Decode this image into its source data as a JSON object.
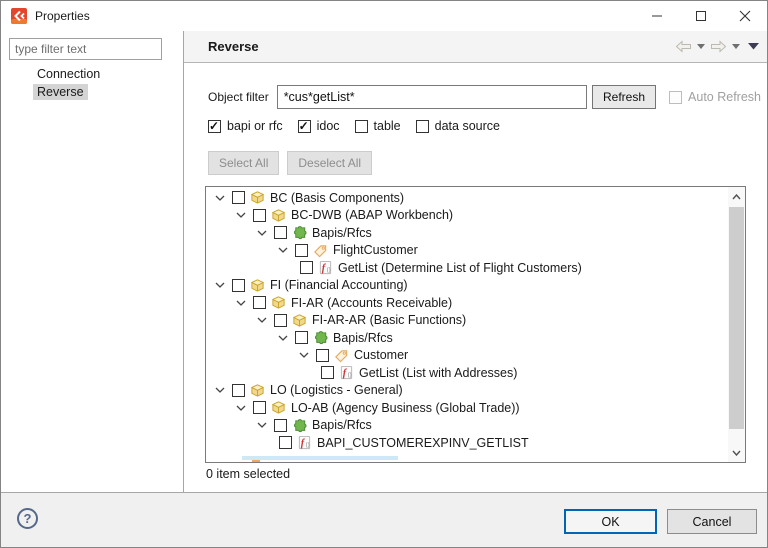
{
  "window": {
    "title": "Properties",
    "controls": [
      {
        "name": "minimize-button",
        "icon": "minimize-icon"
      },
      {
        "name": "maximize-button",
        "icon": "maximize-icon"
      },
      {
        "name": "close-button",
        "icon": "close-icon"
      }
    ],
    "app_icon": "sap-connection-icon"
  },
  "sidebar": {
    "filter_placeholder": "type filter text",
    "items": [
      {
        "label": "Connection",
        "selected": false
      },
      {
        "label": "Reverse",
        "selected": true
      }
    ]
  },
  "header": {
    "title": "Reverse",
    "nav_icons": [
      "back-arrow-icon",
      "back-dropdown-icon",
      "forward-arrow-icon",
      "forward-dropdown-icon",
      "view-menu-icon"
    ]
  },
  "filter_row": {
    "label": "Object filter",
    "value": "*cus*getList*",
    "refresh_label": "Refresh",
    "auto_refresh_label": "Auto Refresh",
    "auto_refresh_checked": false,
    "auto_refresh_enabled": false
  },
  "type_filters": [
    {
      "label": "bapi or rfc",
      "checked": true
    },
    {
      "label": "idoc",
      "checked": true
    },
    {
      "label": "table",
      "checked": false
    },
    {
      "label": "data source",
      "checked": false
    }
  ],
  "actions": {
    "select_all": "Select All",
    "deselect_all": "Deselect All",
    "enabled": false
  },
  "tree": {
    "rows": [
      {
        "level": 0,
        "icon": "package-icon",
        "expandable": true,
        "checked": false,
        "label": "BC (Basis Components)"
      },
      {
        "level": 1,
        "icon": "package-icon",
        "expandable": true,
        "checked": false,
        "label": "BC-DWB (ABAP Workbench)"
      },
      {
        "level": 2,
        "icon": "puzzle-icon",
        "expandable": true,
        "checked": false,
        "label": "Bapis/Rfcs"
      },
      {
        "level": 3,
        "icon": "tag-icon",
        "expandable": true,
        "checked": false,
        "label": "FlightCustomer"
      },
      {
        "level": 4,
        "icon": "function-icon",
        "expandable": false,
        "checked": false,
        "label": "GetList (Determine List of Flight Customers)"
      },
      {
        "level": 0,
        "icon": "package-icon",
        "expandable": true,
        "checked": false,
        "label": "FI (Financial Accounting)"
      },
      {
        "level": 1,
        "icon": "package-icon",
        "expandable": true,
        "checked": false,
        "label": "FI-AR (Accounts Receivable)"
      },
      {
        "level": 2,
        "icon": "package-icon",
        "expandable": true,
        "checked": false,
        "label": "FI-AR-AR (Basic Functions)"
      },
      {
        "level": 3,
        "icon": "puzzle-icon",
        "expandable": true,
        "checked": false,
        "label": "Bapis/Rfcs"
      },
      {
        "level": 4,
        "icon": "tag-icon",
        "expandable": true,
        "checked": false,
        "label": "Customer"
      },
      {
        "level": 5,
        "icon": "function-icon",
        "expandable": false,
        "checked": false,
        "label": "GetList (List with Addresses)"
      },
      {
        "level": 0,
        "icon": "package-icon",
        "expandable": true,
        "checked": false,
        "label": "LO (Logistics - General)"
      },
      {
        "level": 1,
        "icon": "package-icon",
        "expandable": true,
        "checked": false,
        "label": "LO-AB (Agency Business (Global Trade))"
      },
      {
        "level": 2,
        "icon": "puzzle-icon",
        "expandable": true,
        "checked": false,
        "label": "Bapis/Rfcs"
      },
      {
        "level": 3,
        "icon": "function-icon",
        "expandable": false,
        "checked": false,
        "label": "BAPI_CUSTOMEREXPINV_GETLIST"
      }
    ]
  },
  "status": "0 item selected",
  "footer": {
    "help_glyph": "?",
    "ok": "OK",
    "cancel": "Cancel"
  },
  "colors": {
    "ok_border": "#0065b5",
    "selection_gray": "#d4d4d4",
    "header_band": "#f4f4f4",
    "footer_band": "#f0f0f0",
    "app_icon_red": "#e2472e",
    "package_gold": "#f0d98c",
    "puzzle_green": "#72b64e",
    "tag_tan": "#e3a95f",
    "function_red": "#d03030",
    "disabled_text": "#8d8d8d",
    "clipped_row_blue": "#cfe8f8"
  }
}
